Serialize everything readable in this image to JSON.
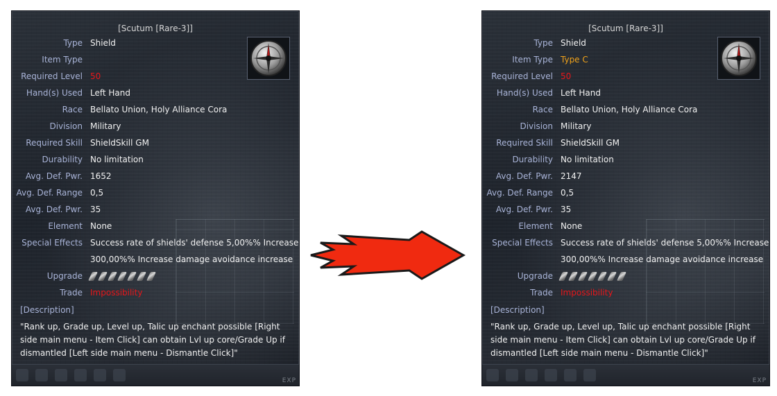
{
  "before": {
    "title": "[Scutum [Rare-3]]",
    "rows": [
      {
        "label": "Type",
        "value": "Shield"
      },
      {
        "label": "Item Type",
        "value": ""
      },
      {
        "label": "Required Level",
        "value": "50"
      },
      {
        "label": "Hand(s) Used",
        "value": "Left Hand"
      },
      {
        "label": "Race",
        "value": "Bellato Union, Holy Alliance Cora"
      },
      {
        "label": "Division",
        "value": "Military"
      },
      {
        "label": "Required Skill",
        "value": "ShieldSkill GM"
      },
      {
        "label": "Durability",
        "value": "No limitation"
      },
      {
        "label": "Avg. Def. Pwr.",
        "value": "1652"
      },
      {
        "label": "Avg. Def. Range",
        "value": "0,5"
      },
      {
        "label": "Avg. Def. Pwr.",
        "value": "35"
      },
      {
        "label": "Element",
        "value": "None"
      },
      {
        "label": "Special Effects",
        "value": "Success rate of shields' defense 5,00%% Increase"
      },
      {
        "label": "",
        "value": "300,00%% Increase damage avoidance increase"
      },
      {
        "label": "Upgrade",
        "value": ""
      },
      {
        "label": "Trade",
        "value": "Impossibility"
      }
    ],
    "description_label": "[Description]",
    "description": "\"Rank up, Grade up, Level up, Talic up enchant possible [Right side main menu - Item Click] can obtain Lvl up core/Grade Up if dismantled [Left side main menu - Dismantle Click]\"",
    "exp_label": "EXP"
  },
  "after": {
    "title": "[Scutum [Rare-3]]",
    "rows": [
      {
        "label": "Type",
        "value": "Shield"
      },
      {
        "label": "Item Type",
        "value": "Type C"
      },
      {
        "label": "Required Level",
        "value": "50"
      },
      {
        "label": "Hand(s) Used",
        "value": "Left Hand"
      },
      {
        "label": "Race",
        "value": "Bellato Union, Holy Alliance Cora"
      },
      {
        "label": "Division",
        "value": "Military"
      },
      {
        "label": "Required Skill",
        "value": "ShieldSkill GM"
      },
      {
        "label": "Durability",
        "value": "No limitation"
      },
      {
        "label": "Avg. Def. Pwr.",
        "value": "2147"
      },
      {
        "label": "Avg. Def. Range",
        "value": "0,5"
      },
      {
        "label": "Avg. Def. Pwr.",
        "value": "35"
      },
      {
        "label": "Element",
        "value": "None"
      },
      {
        "label": "Special Effects",
        "value": "Success rate of shields' defense 5,00%% Increase"
      },
      {
        "label": "",
        "value": "300,00%% Increase damage avoidance increase"
      },
      {
        "label": "Upgrade",
        "value": ""
      },
      {
        "label": "Trade",
        "value": "Impossibility"
      }
    ],
    "description_label": "[Description]",
    "description": "\"Rank up, Grade up, Level up, Talic up enchant possible [Right side main menu - Item Click] can obtain Lvl up core/Grade Up if dismantled [Left side main menu - Dismantle Click]\"",
    "exp_label": "EXP"
  },
  "colors": {
    "label": "#a9b4d8",
    "value": "#f2f2f2",
    "red": "#e8161a",
    "orange": "#f0a21a",
    "arrow": "#f02a10"
  },
  "icons": {
    "item": "shield-compass-icon",
    "upgrade_slot": "talic-slot-icon",
    "arrow": "arrow-right-icon"
  }
}
